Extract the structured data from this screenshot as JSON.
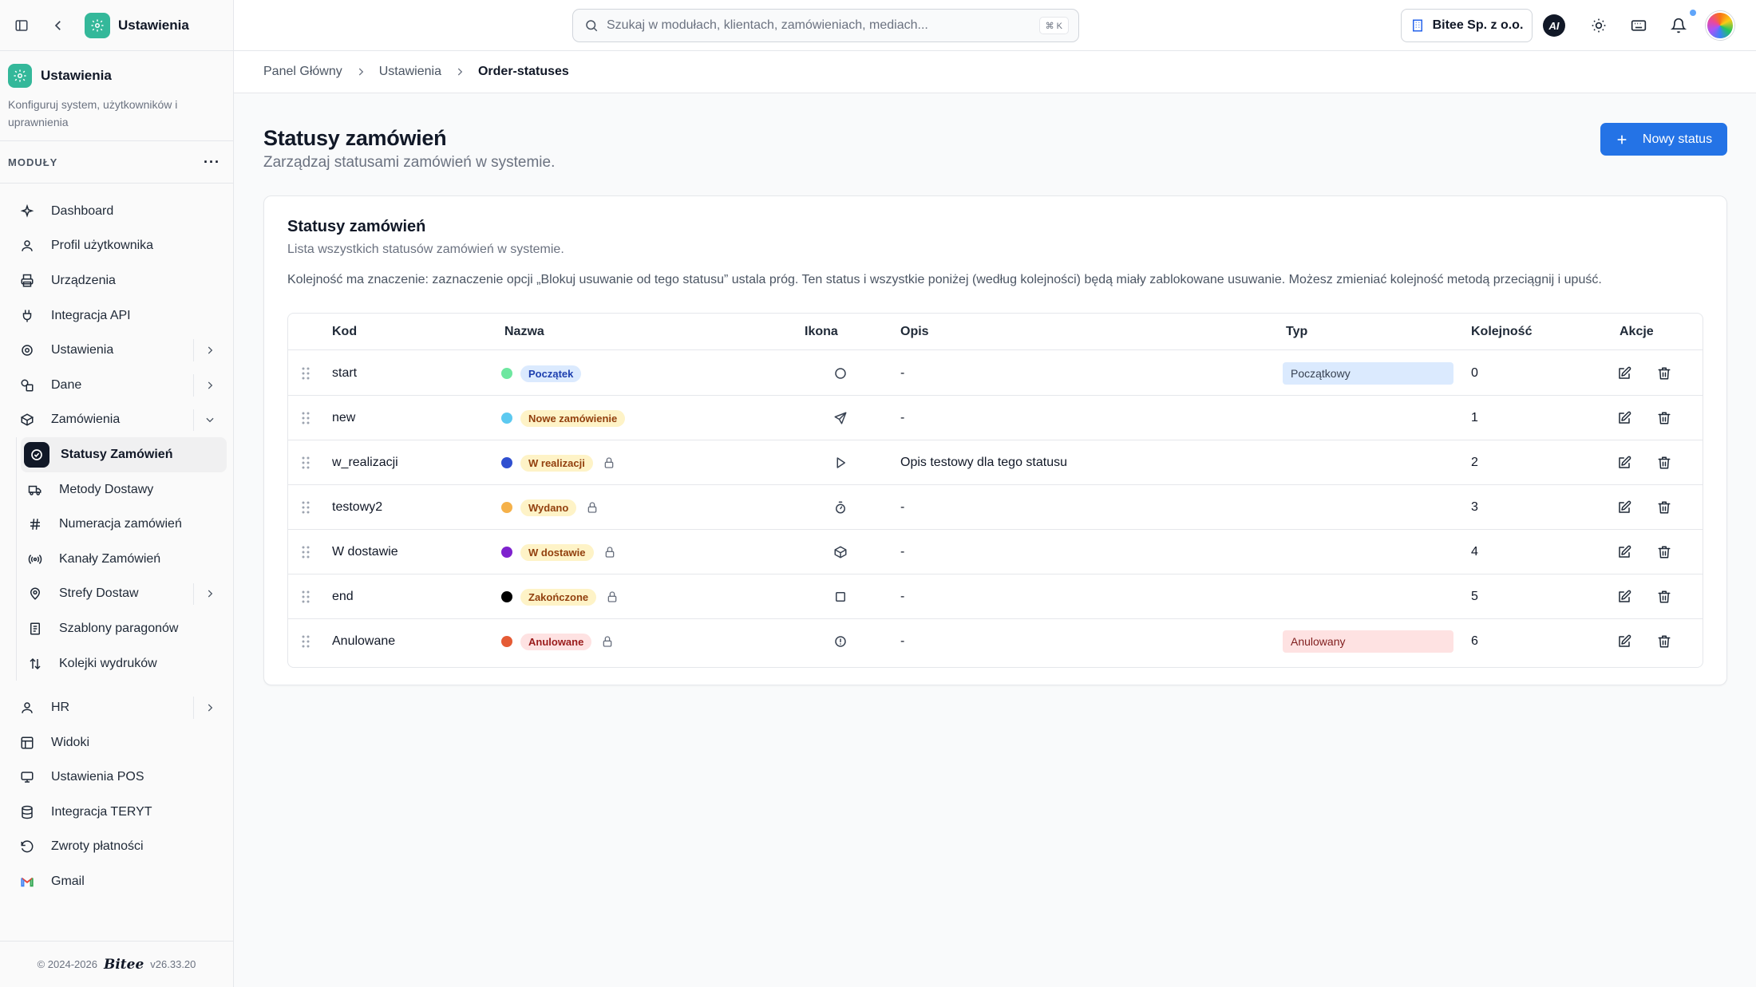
{
  "app": {
    "title": "Ustawienia",
    "module_desc": "Konfiguruj system, użytkowników i uprawnienia",
    "modules_label": "MODUŁY",
    "modules_more": "···",
    "footer_copy": "© 2024-2026",
    "footer_brand": "Bitee",
    "footer_version": "v26.33.20"
  },
  "nav": {
    "dashboard": "Dashboard",
    "profile": "Profil użytkownika",
    "devices": "Urządzenia",
    "api": "Integracja API",
    "settings": "Ustawienia",
    "data": "Dane",
    "orders": "Zamówienia",
    "order_statuses": "Statusy Zamówień",
    "delivery_methods": "Metody Dostawy",
    "order_numbering": "Numeracja zamówień",
    "order_channels": "Kanały Zamówień",
    "delivery_zones": "Strefy Dostaw",
    "receipt_templates": "Szablony paragonów",
    "print_queues": "Kolejki wydruków",
    "hr": "HR",
    "views": "Widoki",
    "pos_settings": "Ustawienia POS",
    "teryt": "Integracja TERYT",
    "refunds": "Zwroty płatności",
    "gmail": "Gmail"
  },
  "topbar": {
    "search_placeholder": "Szukaj w modułach, klientach, zamówieniach, mediach...",
    "shortcut": "⌘ K",
    "company": "Bitee Sp. z o.o.",
    "ai_label": "AI"
  },
  "breadcrumb": [
    "Panel Główny",
    "Ustawienia",
    "Order-statuses"
  ],
  "page": {
    "title": "Statusy zamówień",
    "subtitle": "Zarządzaj statusami zamówień w systemie.",
    "new_button": "Nowy status"
  },
  "card": {
    "title": "Statusy zamówień",
    "subtitle": "Lista wszystkich statusów zamówień w systemie.",
    "note": "Kolejność ma znaczenie: zaznaczenie opcji „Blokuj usuwanie od tego statusu” ustala próg. Ten status i wszystkie poniżej (według kolejności) będą miały zablokowane usuwanie. Możesz zmieniać kolejność metodą przeciągnij i upuść."
  },
  "table": {
    "headers": {
      "code": "Kod",
      "name": "Nazwa",
      "icon": "Ikona",
      "desc": "Opis",
      "type": "Typ",
      "order": "Kolejność",
      "actions": "Akcje"
    },
    "rows": [
      {
        "code": "start",
        "name": "Początek",
        "dot": "#6ee7a0",
        "badge_bg": "#dbeafe",
        "badge_fg": "#1e40af",
        "locked": false,
        "icon": "circle-icon",
        "desc": "-",
        "type": "Początkowy",
        "type_bg": "#dbeafe",
        "type_fg": "#374151",
        "order": "0"
      },
      {
        "code": "new",
        "name": "Nowe zamówienie",
        "dot": "#5cc9f0",
        "badge_bg": "#fef3c7",
        "badge_fg": "#92400e",
        "locked": false,
        "icon": "send-icon",
        "desc": "-",
        "type": "",
        "order": "1"
      },
      {
        "code": "w_realizacji",
        "name": "W realizacji",
        "dot": "#2f4fd0",
        "badge_bg": "#fef3c7",
        "badge_fg": "#92400e",
        "locked": true,
        "icon": "play-icon",
        "desc": "Opis testowy dla tego statusu",
        "type": "",
        "order": "2"
      },
      {
        "code": "testowy2",
        "name": "Wydano",
        "dot": "#f5b14a",
        "badge_bg": "#fef3c7",
        "badge_fg": "#92400e",
        "locked": true,
        "icon": "timer-icon",
        "desc": "-",
        "type": "",
        "order": "3"
      },
      {
        "code": "W dostawie",
        "name": "W dostawie",
        "dot": "#7e22ce",
        "badge_bg": "#fef3c7",
        "badge_fg": "#92400e",
        "locked": true,
        "icon": "package-icon",
        "desc": "-",
        "type": "",
        "order": "4"
      },
      {
        "code": "end",
        "name": "Zakończone",
        "dot": "#000000",
        "badge_bg": "#fef3c7",
        "badge_fg": "#92400e",
        "locked": true,
        "icon": "square-icon",
        "desc": "-",
        "type": "",
        "order": "5"
      },
      {
        "code": "Anulowane",
        "name": "Anulowane",
        "dot": "#e55b35",
        "badge_bg": "#fee2e2",
        "badge_fg": "#991b1b",
        "locked": true,
        "icon": "alert-circle-icon",
        "desc": "-",
        "type": "Anulowany",
        "type_bg": "#fee2e2",
        "type_fg": "#7f1d1d",
        "order": "6"
      }
    ]
  },
  "colors": {
    "accent": "#2473e6",
    "brand": "#34b89a"
  }
}
